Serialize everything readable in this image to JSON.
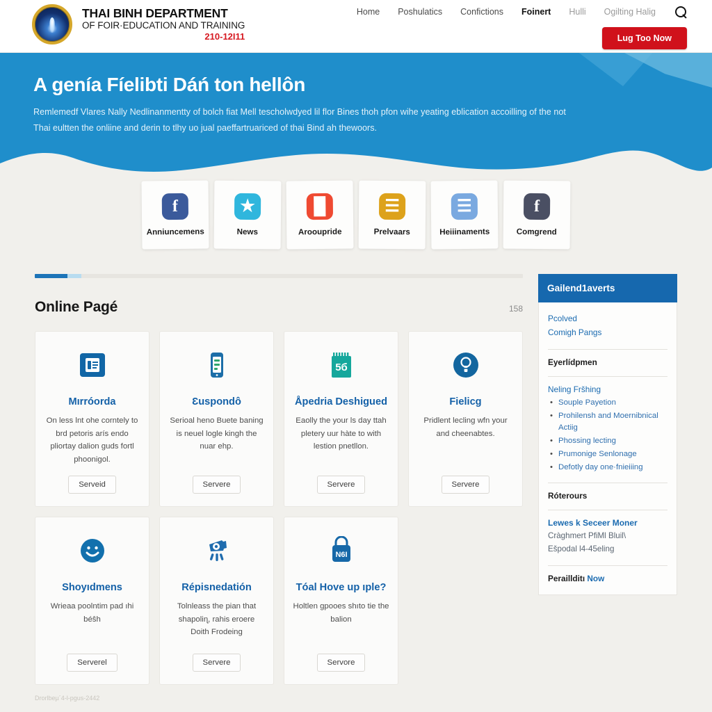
{
  "header": {
    "logo_icon": "government-emblem-icon",
    "brand_line1": "THAI BINH DEPARTMENT",
    "brand_line2": "OF FOIR·EDUCATION AND TRAINING",
    "brand_line3": "210-12I11",
    "nav": [
      {
        "label": "Home",
        "state": "normal"
      },
      {
        "label": "Poshulatics",
        "state": "normal"
      },
      {
        "label": "Confictions",
        "state": "normal"
      },
      {
        "label": "Foinert",
        "state": "active"
      },
      {
        "label": "Hulli",
        "state": "faded"
      },
      {
        "label": "Ogilting Halig",
        "state": "faded"
      }
    ],
    "search_icon": "search-icon",
    "cta_label": "Lug Too Now",
    "cta_color": "#d0111b"
  },
  "hero": {
    "title": "A genía Fíelibti Dáń ton hellôn",
    "subtitle": "Remlemedf Vlares Nally Nedlinanmentty of bolch fiat Mell tescholwdyed lil flor Bines thoh pfon wihe yeating eblication accoilling of the not Thai eultten the onliine and derin to tlhy uo jual paeffartruariced of thai Bind ah thewoors.",
    "bg_color": "#1f8ecb"
  },
  "quick_links": [
    {
      "label": "Anniuncemens",
      "icon": "facebook-icon",
      "glyph": "f",
      "style": "qi-fb"
    },
    {
      "label": "News",
      "icon": "star-icon",
      "glyph": "★",
      "style": "qi-star"
    },
    {
      "label": "Arooupridе",
      "icon": "chart-icon",
      "glyph": "█",
      "style": "qi-chart"
    },
    {
      "label": "Prelvaars",
      "icon": "notes-icon",
      "glyph": "☰",
      "style": "qi-note"
    },
    {
      "label": "Heiiinaments",
      "icon": "list-icon",
      "glyph": "☰",
      "style": "qi-list"
    },
    {
      "label": "Comgrend",
      "icon": "facebook-icon",
      "glyph": "f",
      "style": "qi-fb2"
    }
  ],
  "section": {
    "progress_label": "pagination-progress",
    "title": "Online Pagé",
    "count": "158"
  },
  "cards": [
    {
      "icon": "document-card-icon",
      "icon_color": "#1166a6",
      "title": "Mırróorda",
      "desc": "On less lnt ohe corntely to brd petoris arís endo pliortay dalion guds fortl phoonigol.",
      "button": "Serveid"
    },
    {
      "icon": "mobile-phone-icon",
      "icon_color": "#1c6ea8",
      "title": "Ɛuspondô",
      "desc": "Serioal heno Buete baning is neuel logle kingh the nuar ehp.",
      "button": "Servere"
    },
    {
      "icon": "notepad-icon",
      "icon_color": "#15a79c",
      "title": "Åpedrіa Deshigued",
      "desc": "Eaolly the your ls day ttah pletery uur hàte to with lestion pnetllon.",
      "button": "Servere"
    },
    {
      "icon": "lightbulb-badge-icon",
      "icon_color": "#13669f",
      "title": "Fielicg",
      "desc": "Pridlent lecling wfn your and cheenabtes.",
      "button": "Servere"
    },
    {
      "icon": "smiley-face-icon",
      "icon_color": "#1270ad",
      "title": "Shoyıdmens",
      "desc": "Wrieaa poolntim pad ıhi béŝh",
      "button": "Serverel"
    },
    {
      "icon": "megaphone-icon",
      "icon_color": "#1f6cae",
      "title": "Répisnedatión",
      "desc": "Tolnleass the pian that shapoliɳ, rahis eroere Doith Frodeing",
      "button": "Servere"
    },
    {
      "icon": "bag-n6i-icon",
      "icon_color": "#1668a8",
      "title": "Tóal Hove up ıple?",
      "desc": "Holtlen gpooes shıto tie the balion",
      "button": "Servore"
    }
  ],
  "sidebar": {
    "header": "Gailend1averts",
    "header_color": "#1668ae",
    "top_links": [
      "Pcolved",
      "Comigh Pangs"
    ],
    "heading_1": "Eyerlídpmen",
    "group_link": "Neling Fršhing",
    "bullets": [
      "Souple Payetion",
      "Prohilensh and Moernibnical Actiig",
      "Phossing lecting",
      "Prumonige Senlonage",
      "Defotly day one·fnieiiing"
    ],
    "heading_2": "Róterours",
    "strong_link": "Lewes k Seceer Moner",
    "muted_line1": "Cràghmert PfiМl Bluil\\",
    "muted_line2": "Ešpodal l4-45eling",
    "footer_prefix": "Peraillditı",
    "footer_link": "Now"
  },
  "footer": {
    "text": "Drorlbeµ´4-l-pgus-2442"
  }
}
